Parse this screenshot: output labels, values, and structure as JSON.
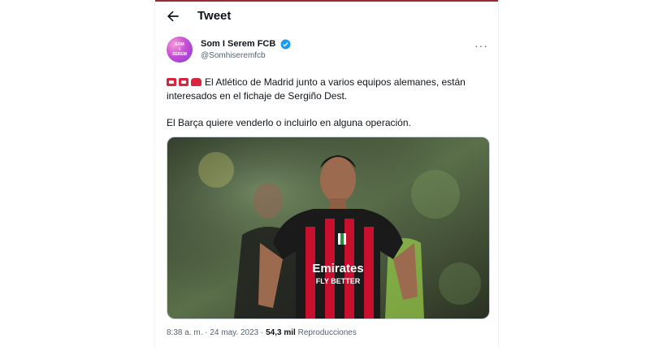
{
  "header": {
    "title": "Tweet"
  },
  "author": {
    "name": "Som I Serem FCB",
    "handle": "@Somhiseremfcb",
    "avatar_text": [
      "SOM",
      "I",
      "SEREM"
    ]
  },
  "tweet": {
    "line1": "El Atlético de Madrid junto a varios equipos alemanes, están interesados en el fichaje de Sergiño Dest.",
    "line2": "El Barça quiere venderlo o incluirlo en alguna operación."
  },
  "media": {
    "shirt_text": "Emirates",
    "shirt_subtext": "FLY BETTER"
  },
  "meta": {
    "time": "8:38 a. m.",
    "sep": " · ",
    "date": "24 may. 2023",
    "sep2": " · ",
    "views": "54,3 mil",
    "views_label": " Reproducciones"
  },
  "colors": {
    "accent": "#1d9bf0",
    "brand": "#9b2a36",
    "milan_red": "#c8102e"
  },
  "icons": {
    "back": "arrow-left-icon",
    "verified": "verified-badge-icon",
    "more": "more-horizontal-icon",
    "flags": "flag-emoji-icons"
  }
}
